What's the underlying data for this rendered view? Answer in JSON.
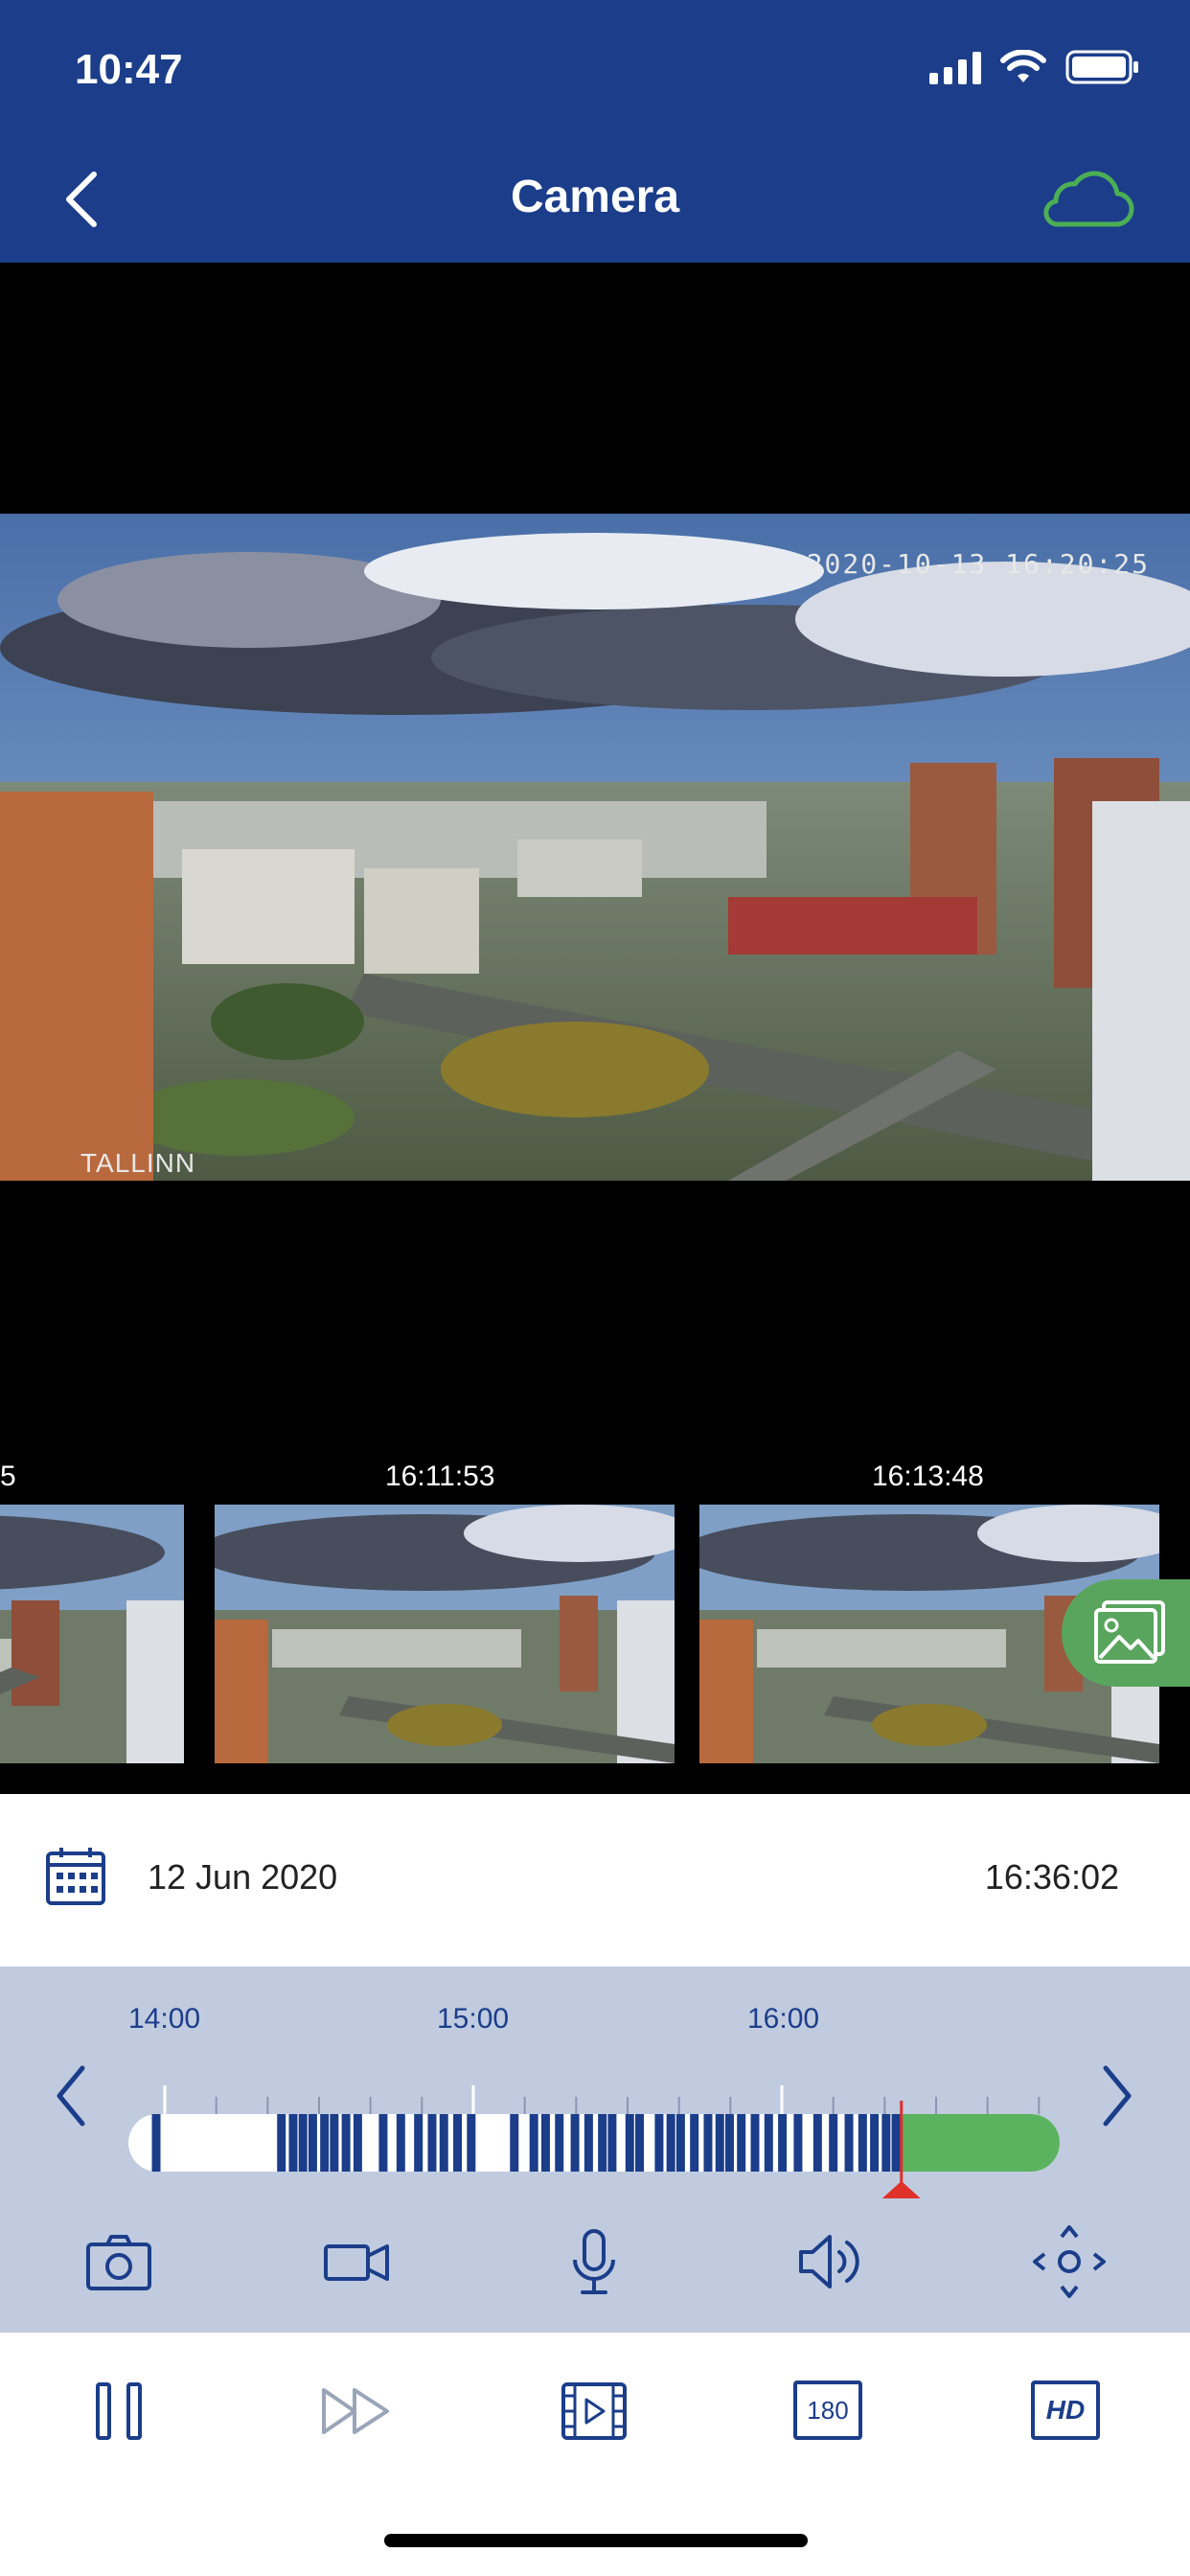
{
  "status_bar": {
    "time": "10:47"
  },
  "header": {
    "title": "Camera"
  },
  "feed": {
    "timestamp": "2020-10-13 16:20:25",
    "location": "TALLINN"
  },
  "thumbnails": [
    {
      "time": "5"
    },
    {
      "time": "16:11:53"
    },
    {
      "time": "16:13:48"
    }
  ],
  "date_bar": {
    "date": "12 Jun 2020",
    "time": "16:36:02"
  },
  "timeline": {
    "hour_labels": [
      "14:00",
      "15:00",
      "16:00"
    ],
    "cursor_position": 0.83
  },
  "controls": {
    "tools": [
      "camera-icon",
      "video-camera-icon",
      "microphone-icon",
      "speaker-icon",
      "ptz-move-icon"
    ],
    "playback": [
      "pause-icon",
      "fast-forward-icon",
      "clip-icon",
      "rotate-180-icon",
      "hd-icon"
    ],
    "rotate_label": "180",
    "hd_label": "HD"
  },
  "colors": {
    "brand": "#1b3d8a",
    "accent_green": "#5aa55e",
    "panel": "#c0cbe0",
    "cursor_red": "#e0302a"
  }
}
